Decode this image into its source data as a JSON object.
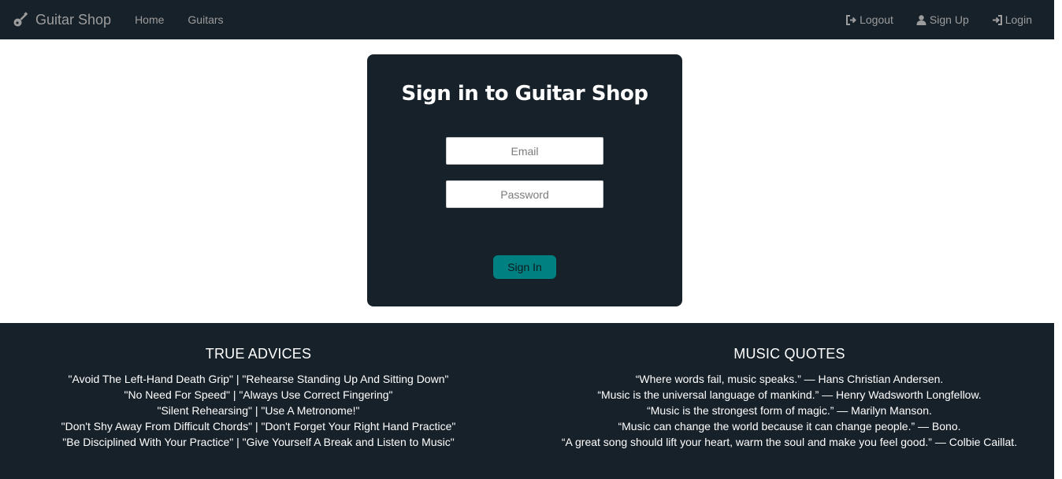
{
  "nav": {
    "brand": "Guitar Shop",
    "left_links": [
      "Home",
      "Guitars"
    ],
    "right_links": [
      {
        "label": "Logout",
        "icon": "logout-icon"
      },
      {
        "label": "Sign Up",
        "icon": "user-icon"
      },
      {
        "label": "Login",
        "icon": "login-icon"
      }
    ]
  },
  "signin": {
    "title": "Sign in to Guitar Shop",
    "email_placeholder": "Email",
    "password_placeholder": "Password",
    "button_label": "Sign In"
  },
  "footer": {
    "advices_title": "TRUE ADVICES",
    "advices": [
      "\"Avoid The Left-Hand Death Grip\" | \"Rehearse Standing Up And Sitting Down\"",
      "\"No Need For Speed\" | \"Always Use Correct Fingering\"",
      "\"Silent Rehearsing\" | \"Use A Metronome!\"",
      "\"Don't Shy Away From Difficult Chords\" | \"Don't Forget Your Right Hand Practice\"",
      "\"Be Disciplined With Your Practice\" | \"Give Yourself A Break and Listen to Music\""
    ],
    "quotes_title": "MUSIC QUOTES",
    "quotes": [
      "“Where words fail, music speaks.” — Hans Christian Andersen.",
      "“Music is the universal language of mankind.” — Henry Wadsworth Longfellow.",
      "“Music is the strongest form of magic.” — Marilyn Manson.",
      "“Music can change the world because it can change people.” — Bono.",
      "“A great song should lift your heart, warm the soul and make you feel good.” — Colbie Caillat."
    ]
  },
  "colors": {
    "navbar_bg": "#17212a",
    "nav_text": "#9d9d9d",
    "accent": "#008080"
  }
}
